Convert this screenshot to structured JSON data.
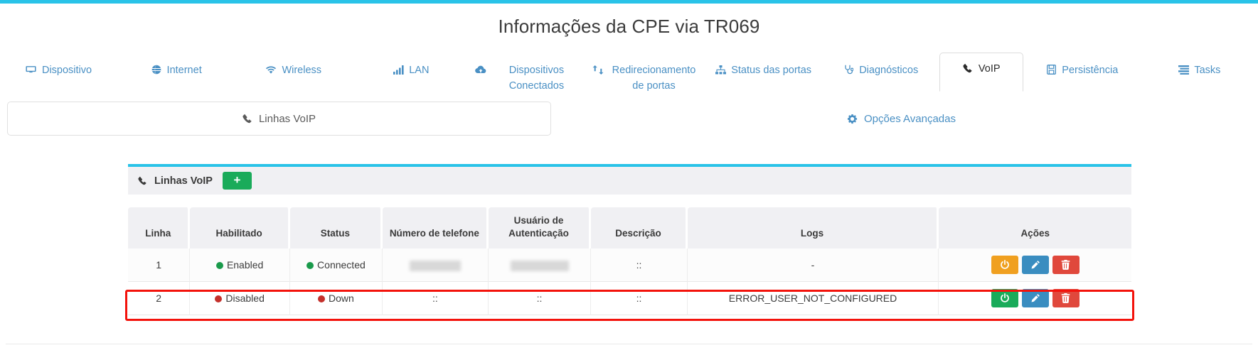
{
  "header": {
    "title": "Informações da CPE via TR069",
    "accent_color": "#29c3e8"
  },
  "nav_tabs": [
    {
      "label": "Dispositivo",
      "icon": "device-icon",
      "active": false
    },
    {
      "label": "Internet",
      "icon": "globe-icon",
      "active": false
    },
    {
      "label": "Wireless",
      "icon": "wifi-icon",
      "active": false
    },
    {
      "label": "LAN",
      "icon": "signal-bars-icon",
      "active": false
    },
    {
      "label": "Dispositivos Conectados",
      "icon": "connected-devices-icon",
      "active": false
    },
    {
      "label": "Redirecionamento de portas",
      "icon": "port-forward-icon",
      "active": false
    },
    {
      "label": "Status das portas",
      "icon": "sitemap-icon",
      "active": false
    },
    {
      "label": "Diagnósticos",
      "icon": "stethoscope-icon",
      "active": false
    },
    {
      "label": "VoIP",
      "icon": "phone-icon",
      "active": true
    },
    {
      "label": "Persistência",
      "icon": "save-disk-icon",
      "active": false
    },
    {
      "label": "Tasks",
      "icon": "tasks-icon",
      "active": false
    }
  ],
  "sub_tabs": [
    {
      "label": "Linhas VoIP",
      "icon": "phone-icon",
      "active": true
    },
    {
      "label": "Opções Avançadas",
      "icon": "gear-icon",
      "active": false
    }
  ],
  "panel": {
    "title": "Linhas VoIP",
    "title_icon": "phone-icon",
    "add_button_label": "+",
    "add_button_color": "#1aab5a",
    "accent_color": "#29c3e8"
  },
  "table": {
    "columns": [
      "Linha",
      "Habilitado",
      "Status",
      "Número de telefone",
      "Usuário de Autenticação",
      "Descrição",
      "Logs",
      "Ações"
    ],
    "rows": [
      {
        "linha": "1",
        "habilitado": "Enabled",
        "habilitado_state": "green",
        "status": "Connected",
        "status_state": "green",
        "telefone": "",
        "telefone_redacted": true,
        "usuario": "",
        "usuario_redacted": true,
        "descricao": "::",
        "logs": "-",
        "actions": [
          {
            "name": "power-button",
            "state": "on",
            "color": "#f0a020",
            "icon": "power-icon"
          },
          {
            "name": "edit-button",
            "state": "",
            "color": "#3a8dc0",
            "icon": "pencil-icon"
          },
          {
            "name": "delete-button",
            "state": "",
            "color": "#e0483c",
            "icon": "trash-icon"
          }
        ],
        "highlighted": false
      },
      {
        "linha": "2",
        "habilitado": "Disabled",
        "habilitado_state": "red",
        "status": "Down",
        "status_state": "red",
        "telefone": "::",
        "telefone_redacted": false,
        "usuario": "::",
        "usuario_redacted": false,
        "descricao": "::",
        "logs": "ERROR_USER_NOT_CONFIGURED",
        "actions": [
          {
            "name": "power-button",
            "state": "off",
            "color": "#1aab5a",
            "icon": "power-icon"
          },
          {
            "name": "edit-button",
            "state": "",
            "color": "#3a8dc0",
            "icon": "pencil-icon"
          },
          {
            "name": "delete-button",
            "state": "",
            "color": "#e0483c",
            "icon": "trash-icon"
          }
        ],
        "highlighted": true
      }
    ]
  },
  "annotation": {
    "highlight_color": "#f3120b"
  }
}
